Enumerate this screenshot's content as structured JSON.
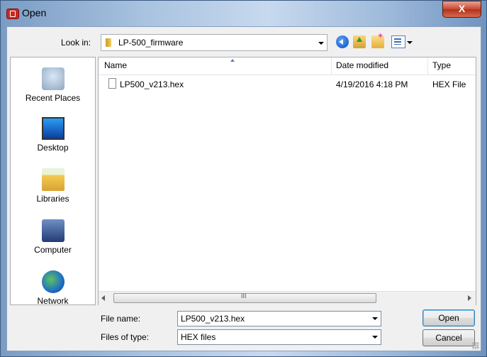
{
  "window": {
    "title": "Open",
    "close_glyph": "X"
  },
  "toolbar": {
    "look_in_label": "Look in:",
    "look_in_value": "LP-500_firmware",
    "icons": [
      "back-icon",
      "up-folder-icon",
      "new-folder-icon",
      "views-menu-icon"
    ]
  },
  "places": [
    {
      "label": "Recent Places",
      "icon": "recent-places-icon"
    },
    {
      "label": "Desktop",
      "icon": "desktop-icon"
    },
    {
      "label": "Libraries",
      "icon": "libraries-icon"
    },
    {
      "label": "Computer",
      "icon": "computer-icon"
    },
    {
      "label": "Network",
      "icon": "network-icon"
    }
  ],
  "file_list": {
    "columns": [
      "Name",
      "Date modified",
      "Type"
    ],
    "rows": [
      {
        "name": "LP500_v213.hex",
        "date_modified": "4/19/2016 4:18 PM",
        "type": "HEX File"
      }
    ],
    "scroll_grip": "III"
  },
  "form": {
    "file_name_label": "File name:",
    "file_name_value": "LP500_v213.hex",
    "file_type_label": "Files of type:",
    "file_type_value": "HEX files"
  },
  "buttons": {
    "open": "Open",
    "cancel": "Cancel"
  },
  "colors": {
    "title_gradient_start": "#7a9cc4",
    "close_button": "#c9482e",
    "face": "#f0f0f0"
  }
}
